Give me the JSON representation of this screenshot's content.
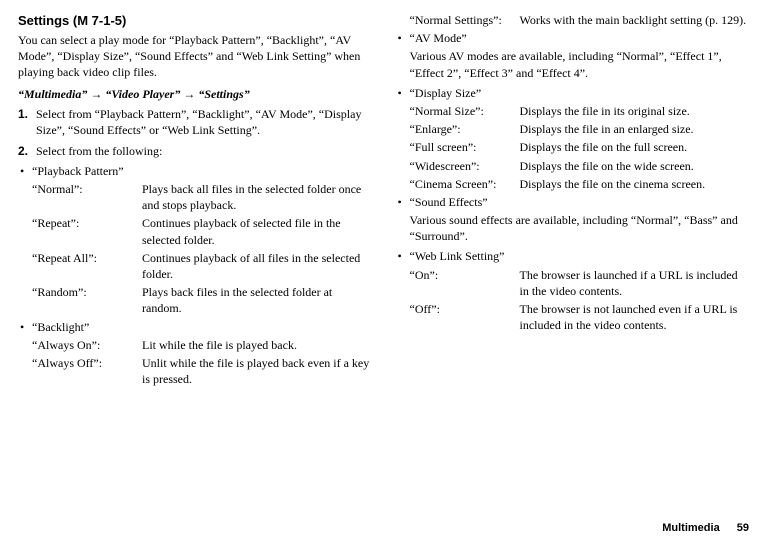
{
  "heading": "Settings (M 7-1-5)",
  "intro": "You can select a play mode for “Playback Pattern”, “Backlight”, “AV Mode”, “Display Size”, “Sound Effects” and “Web Link Setting” when playing back video clip files.",
  "nav": {
    "p1": "“Multimedia”",
    "p2": "“Video Player”",
    "p3": "“Settings”",
    "arrow": "→"
  },
  "steps": {
    "s1": {
      "num": "1.",
      "text": "Select from “Playback Pattern”, “Backlight”, “AV Mode”, “Display Size”, “Sound Effects” or “Web Link Setting”."
    },
    "s2": {
      "num": "2.",
      "text": "Select from the following:"
    }
  },
  "playback": {
    "title": "“Playback Pattern”",
    "normal_k": "“Normal”:",
    "normal_v": "Plays back all files in the selected folder once and stops playback.",
    "repeat_k": "“Repeat”:",
    "repeat_v": "Continues playback of selected file in the selected folder.",
    "repeatall_k": "“Repeat All”:",
    "repeatall_v": "Continues playback of all files in the selected folder.",
    "random_k": "“Random”:",
    "random_v": "Plays back files in the selected folder at random."
  },
  "backlight": {
    "title": "“Backlight”",
    "on_k": "“Always On”:",
    "on_v": "Lit while the file is played back.",
    "off_k": "“Always Off”:",
    "off_v": "Unlit while the file is played back even if a key is pressed.",
    "ns_k": "“Normal Settings”:",
    "ns_v": "Works with the main backlight setting (p. 129)."
  },
  "av": {
    "title": "“AV Mode”",
    "desc": "Various AV modes are available, including “Normal”, “Effect 1”, “Effect 2”, “Effect 3” and “Effect 4”."
  },
  "display": {
    "title": "“Display Size”",
    "normal_k": "“Normal Size”:",
    "normal_v": "Displays the file in its original size.",
    "enlarge_k": "“Enlarge”:",
    "enlarge_v": "Displays the file in an enlarged size.",
    "full_k": "“Full screen”:",
    "full_v": "Displays the file on the full screen.",
    "wide_k": "“Widescreen”:",
    "wide_v": "Displays the file on the wide screen.",
    "cinema_k": "“Cinema Screen”:",
    "cinema_v": "Displays the file on the cinema screen."
  },
  "sound": {
    "title": "“Sound Effects”",
    "desc": "Various sound effects are available, including “Normal”, “Bass” and “Surround”."
  },
  "weblink": {
    "title": "“Web Link Setting”",
    "on_k": "“On”:",
    "on_v": "The browser is launched if a URL is included in the video contents.",
    "off_k": "“Off”:",
    "off_v": "The browser is not launched even if a URL is included in the video contents."
  },
  "footer": {
    "label": "Multimedia",
    "page": "59"
  }
}
